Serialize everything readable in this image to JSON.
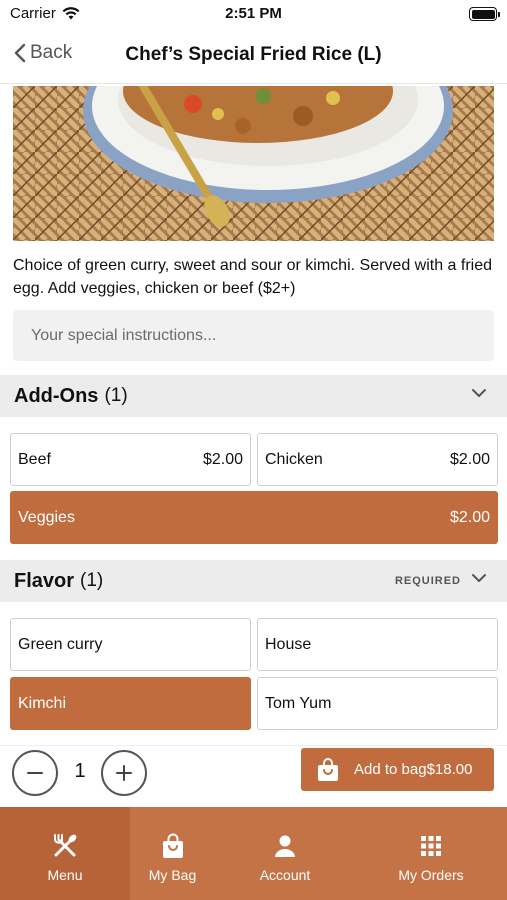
{
  "status_bar": {
    "carrier": "Carrier",
    "time": "2:51 PM"
  },
  "nav": {
    "back_label": "Back",
    "title": "Chef’s Special Fried Rice (L)"
  },
  "description": "Choice of green curry, sweet and sour or kimchi. Served with a fried egg. Add veggies, chicken or beef ($2+)",
  "instructions": {
    "placeholder": "Your special instructions..."
  },
  "addons": {
    "title": "Add-Ons",
    "count": "(1)",
    "options": [
      {
        "label": "Beef",
        "price": "$2.00",
        "selected": false
      },
      {
        "label": "Chicken",
        "price": "$2.00",
        "selected": false
      },
      {
        "label": "Veggies",
        "price": "$2.00",
        "selected": true
      }
    ]
  },
  "flavor": {
    "title": "Flavor",
    "count": "(1)",
    "required_label": "REQUIRED",
    "options": [
      {
        "label": "Green curry",
        "selected": false
      },
      {
        "label": "House",
        "selected": false
      },
      {
        "label": "Kimchi",
        "selected": true
      },
      {
        "label": "Tom Yum",
        "selected": false
      }
    ]
  },
  "quantity": {
    "value": "1"
  },
  "add_to_bag": {
    "label": "Add to bag",
    "price": "$18.00"
  },
  "tabs": [
    {
      "label": "Menu",
      "icon": "utensils-icon",
      "active": true
    },
    {
      "label": "My Bag",
      "icon": "bag-icon",
      "active": false
    },
    {
      "label": "Account",
      "icon": "person-icon",
      "active": false
    },
    {
      "label": "My Orders",
      "icon": "grid-icon",
      "active": false
    }
  ],
  "colors": {
    "accent": "#c06c3f",
    "tab_bar": "#c47347",
    "tab_active": "#b6633a",
    "section_bg": "#ececec"
  }
}
